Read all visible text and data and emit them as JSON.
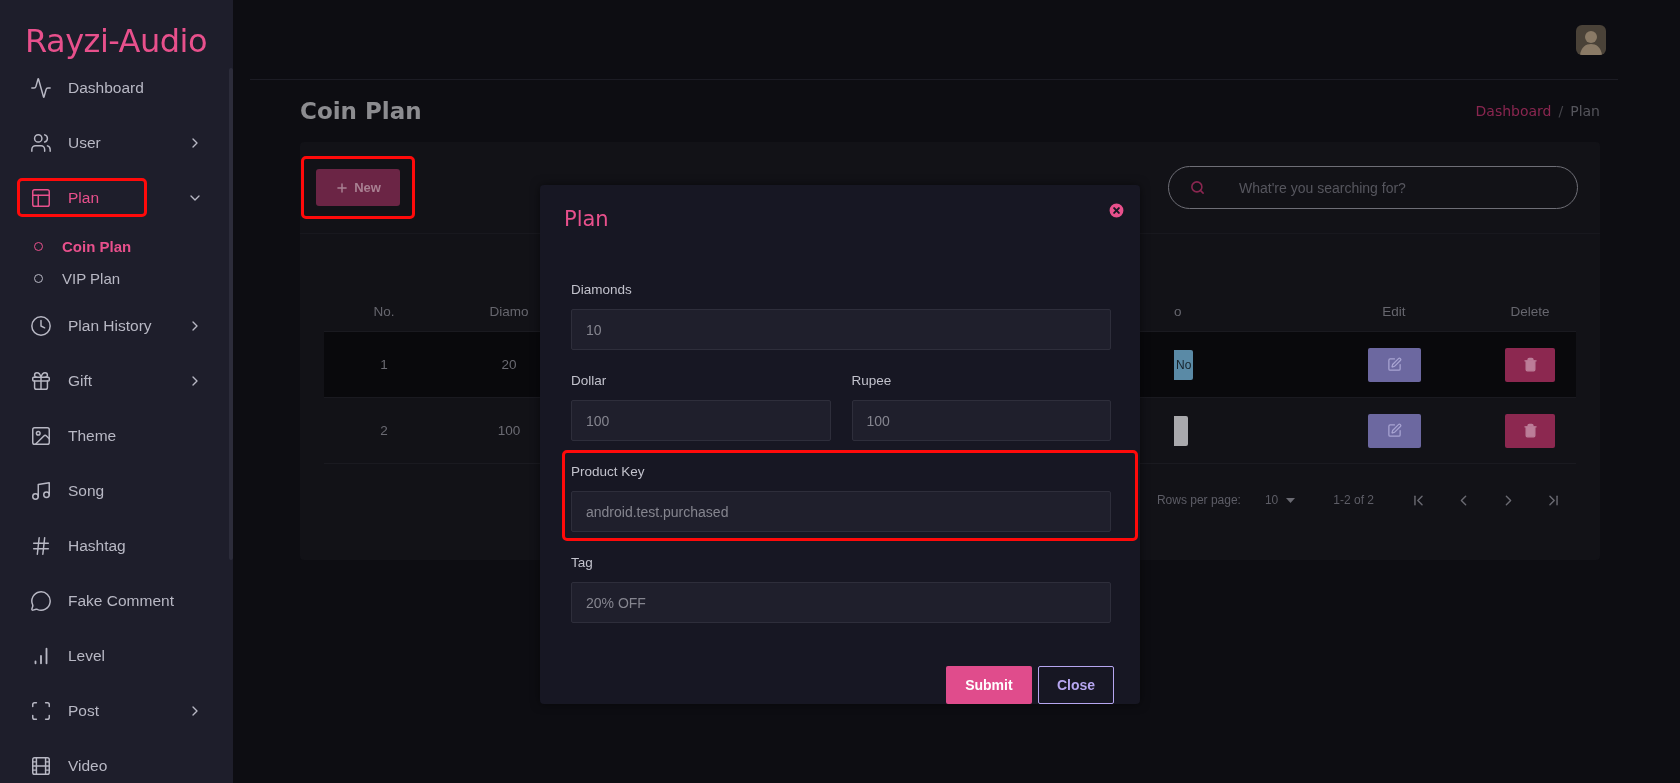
{
  "sidebar": {
    "logo": "Rayzi-Audio",
    "items": [
      {
        "label": "Dashboard",
        "expandable": false,
        "selected": false,
        "highlighted": false
      },
      {
        "label": "User",
        "expandable": true,
        "expanded": false,
        "selected": false,
        "highlighted": false
      },
      {
        "label": "Plan",
        "expandable": true,
        "expanded": true,
        "selected": true,
        "highlighted": true,
        "children": [
          {
            "label": "Coin Plan",
            "selected": true
          },
          {
            "label": "VIP Plan",
            "selected": false
          }
        ]
      },
      {
        "label": "Plan History",
        "expandable": true,
        "expanded": false,
        "selected": false,
        "highlighted": false
      },
      {
        "label": "Gift",
        "expandable": true,
        "expanded": false,
        "selected": false,
        "highlighted": false
      },
      {
        "label": "Theme",
        "expandable": false,
        "selected": false,
        "highlighted": false
      },
      {
        "label": "Song",
        "expandable": false,
        "selected": false,
        "highlighted": false
      },
      {
        "label": "Hashtag",
        "expandable": false,
        "selected": false,
        "highlighted": false
      },
      {
        "label": "Fake Comment",
        "expandable": false,
        "selected": false,
        "highlighted": false
      },
      {
        "label": "Level",
        "expandable": false,
        "selected": false,
        "highlighted": false
      },
      {
        "label": "Post",
        "expandable": true,
        "expanded": false,
        "selected": false,
        "highlighted": false
      },
      {
        "label": "Video",
        "expandable": false,
        "selected": false,
        "highlighted": false
      }
    ]
  },
  "page": {
    "title": "Coin Plan",
    "breadcrumb_separator": "/",
    "breadcrumb": [
      {
        "label": "Dashboard",
        "link": true
      },
      {
        "label": "Plan",
        "link": false
      }
    ]
  },
  "toolbar": {
    "new_button": {
      "label": "New",
      "highlighted": true
    },
    "search": {
      "placeholder": "What're you searching for?"
    }
  },
  "table": {
    "columns": [
      "No.",
      "Diamo",
      "o",
      "Edit",
      "Delete"
    ],
    "rows": [
      {
        "cells": [
          "1",
          "20"
        ],
        "badge": {
          "label": "No",
          "color": "#5a8aa6"
        }
      },
      {
        "cells": [
          "2",
          "100"
        ],
        "badge": {
          "color": "#a9a9ad"
        }
      }
    ]
  },
  "pagination": {
    "rows_per_page_label": "Rows per page:",
    "rows_per_page": "10",
    "range": "1-2 of 2"
  },
  "modal": {
    "title": "Plan",
    "rows": [
      [
        {
          "label": "Diamonds",
          "value": "10",
          "highlighted": false
        }
      ],
      [
        {
          "label": "Dollar",
          "value": "100",
          "highlighted": false
        },
        {
          "label": "Rupee",
          "value": "100",
          "highlighted": false
        }
      ],
      [
        {
          "label": "Product Key",
          "value": "android.test.purchased",
          "highlighted": true
        }
      ],
      [
        {
          "label": "Tag",
          "value": "20% OFF",
          "highlighted": false
        }
      ]
    ],
    "buttons": [
      {
        "label": "Submit",
        "kind": "primary"
      },
      {
        "label": "Close",
        "kind": "outline"
      }
    ]
  }
}
